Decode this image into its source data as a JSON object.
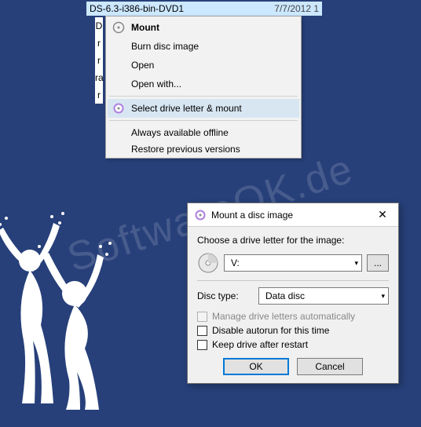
{
  "file": {
    "name": "DS-6.3-i386-bin-DVD1",
    "date": "7/7/2012 1"
  },
  "side_letters": [
    "D",
    "r",
    "r",
    "ra",
    "r"
  ],
  "context_menu": {
    "mount": "Mount",
    "burn": "Burn disc image",
    "open": "Open",
    "open_with": "Open with...",
    "select_mount": "Select drive letter & mount",
    "offline": "Always available offline",
    "restore": "Restore previous versions"
  },
  "dialog": {
    "title": "Mount a disc image",
    "choose_label": "Choose a drive letter for the image:",
    "drive_letter": "V:",
    "browse": "...",
    "disc_type_label": "Disc type:",
    "disc_type_value": "Data disc",
    "chk_manage": "Manage drive letters automatically",
    "chk_autorun": "Disable autorun for this time",
    "chk_keep": "Keep drive after restart",
    "ok": "OK",
    "cancel": "Cancel",
    "close": "✕"
  },
  "watermark": "SoftwareOK.de"
}
